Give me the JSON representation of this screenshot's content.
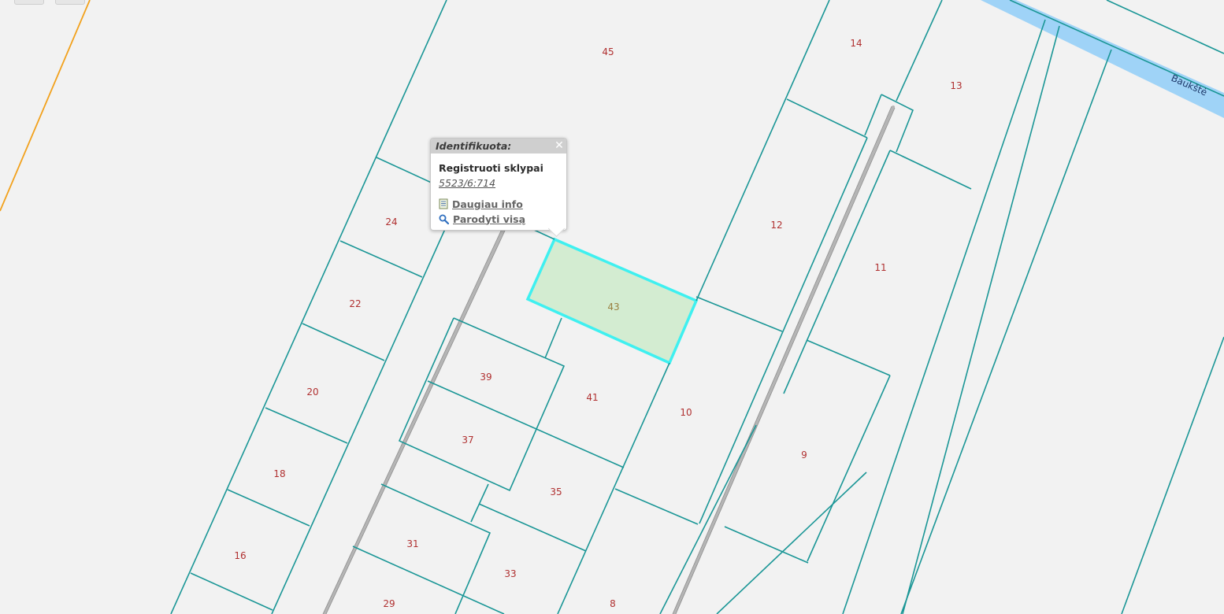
{
  "colors": {
    "parcel_outline": "#1a9696",
    "plot_number": "#b03030",
    "selected_fill": "#d3ecd1",
    "selected_outline": "#3ff0f0",
    "river": "#9fd3f7",
    "road": "#b5b5b5",
    "boundary": "#f2a11c",
    "background": "#f2f2f2"
  },
  "river": {
    "name": "Baukštė"
  },
  "plots": [
    {
      "number": "45"
    },
    {
      "number": "14"
    },
    {
      "number": "13"
    },
    {
      "number": "24"
    },
    {
      "number": "12"
    },
    {
      "number": "22"
    },
    {
      "number": "11"
    },
    {
      "number": "43"
    },
    {
      "number": "20"
    },
    {
      "number": "39"
    },
    {
      "number": "41"
    },
    {
      "number": "10"
    },
    {
      "number": "37"
    },
    {
      "number": "9"
    },
    {
      "number": "18"
    },
    {
      "number": "35"
    },
    {
      "number": "16"
    },
    {
      "number": "31"
    },
    {
      "number": "33"
    },
    {
      "number": "29"
    },
    {
      "number": "8"
    }
  ],
  "popup": {
    "title": "Identifikuota:",
    "close_icon": "close-icon",
    "layer_name": "Registruoti sklypai",
    "parcel_id": "5523/6:714",
    "more_info_icon": "document-icon",
    "more_info_label": "Daugiau info",
    "show_all_icon": "magnifier-icon",
    "show_all_label": "Parodyti visą"
  }
}
